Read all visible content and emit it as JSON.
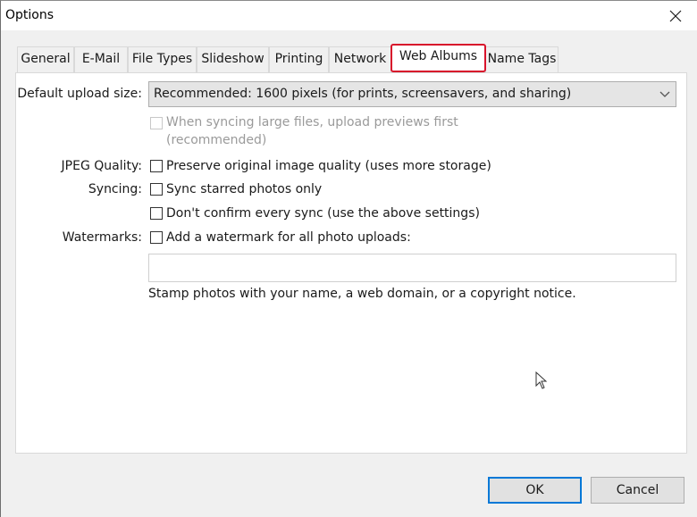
{
  "window": {
    "title": "Options",
    "close_icon": "close-icon"
  },
  "tabs": [
    {
      "label": "General",
      "active": false
    },
    {
      "label": "E-Mail",
      "active": false
    },
    {
      "label": "File Types",
      "active": false
    },
    {
      "label": "Slideshow",
      "active": false
    },
    {
      "label": "Printing",
      "active": false
    },
    {
      "label": "Network",
      "active": false
    },
    {
      "label": "Web Albums",
      "active": true
    },
    {
      "label": "Name Tags",
      "active": false
    }
  ],
  "web_albums": {
    "upload_size": {
      "label": "Default upload size:",
      "selected": "Recommended: 1600 pixels (for prints, screensavers, and sharing)"
    },
    "upload_previews": {
      "label_line1": "When syncing large files, upload previews first",
      "label_line2": "(recommended)",
      "checked": false,
      "disabled": true
    },
    "jpeg_quality": {
      "label": "JPEG Quality:",
      "option": "Preserve original image quality (uses more storage)",
      "checked": false
    },
    "syncing": {
      "label": "Syncing:",
      "starred_only": "Sync starred photos only",
      "starred_only_checked": false,
      "dont_confirm": "Don't confirm every sync (use the above settings)",
      "dont_confirm_checked": false
    },
    "watermarks": {
      "label": "Watermarks:",
      "option": "Add a watermark for all photo uploads:",
      "checked": false,
      "text_value": "",
      "hint": "Stamp photos with your name, a web domain, or a copyright notice."
    }
  },
  "buttons": {
    "ok": "OK",
    "cancel": "Cancel"
  }
}
